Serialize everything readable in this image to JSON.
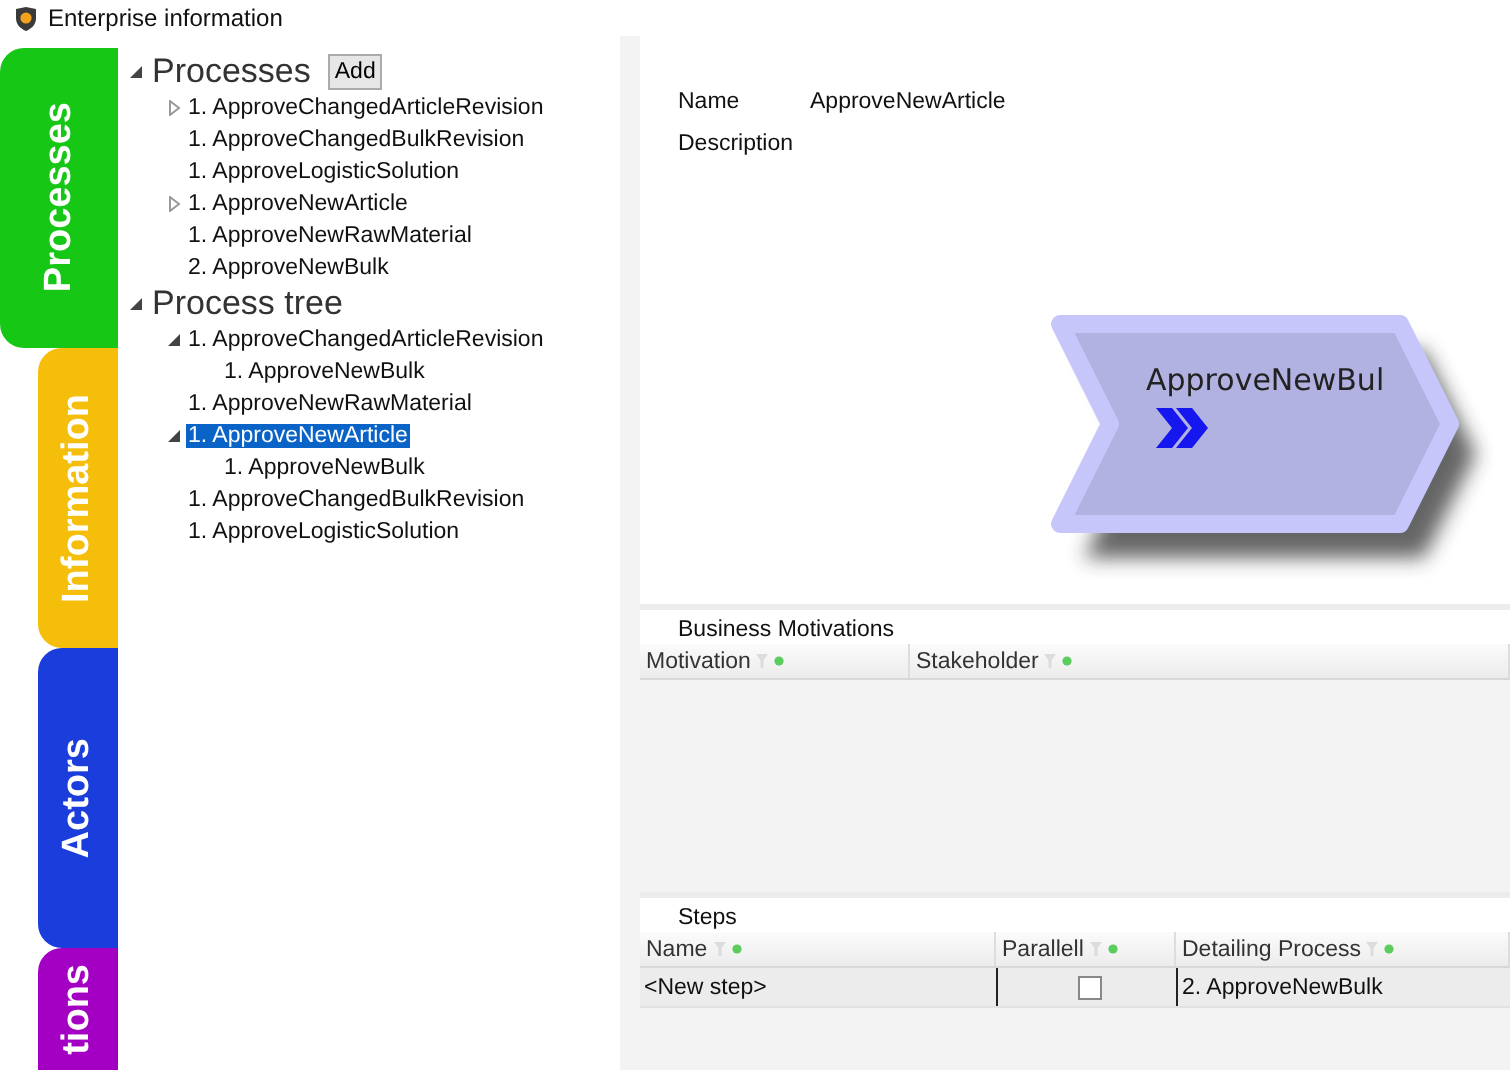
{
  "window": {
    "title": "Enterprise information"
  },
  "side_tabs": [
    {
      "label": "Processes",
      "color": "#16c716",
      "selected": true
    },
    {
      "label": "Information",
      "color": "#f5be0a",
      "selected": false
    },
    {
      "label": "Actors",
      "color": "#1a3ddc",
      "selected": false
    },
    {
      "label": "tions",
      "color": "#a400c4",
      "selected": false
    }
  ],
  "tree": [
    {
      "label": "Processes",
      "expanded": true,
      "button": "Add",
      "children": [
        {
          "label": "1. ApproveChangedArticleRevision",
          "expanded": false,
          "selected": false
        },
        {
          "label": "1. ApproveChangedBulkRevision",
          "selected": false
        },
        {
          "label": "1. ApproveLogisticSolution",
          "selected": false
        },
        {
          "label": "1. ApproveNewArticle",
          "expanded": false,
          "selected": false
        },
        {
          "label": "1. ApproveNewRawMaterial",
          "selected": false
        },
        {
          "label": "2. ApproveNewBulk",
          "selected": false
        }
      ]
    },
    {
      "label": "Process tree",
      "expanded": true,
      "children": [
        {
          "label": "1. ApproveChangedArticleRevision",
          "expanded": true,
          "selected": false,
          "children": [
            {
              "label": "1. ApproveNewBulk",
              "selected": false
            }
          ]
        },
        {
          "label": "1. ApproveNewRawMaterial",
          "selected": false
        },
        {
          "label": "1. ApproveNewArticle",
          "expanded": true,
          "selected": true,
          "children": [
            {
              "label": "1. ApproveNewBulk",
              "selected": false
            }
          ]
        },
        {
          "label": "1. ApproveChangedBulkRevision",
          "selected": false
        },
        {
          "label": "1. ApproveLogisticSolution",
          "selected": false
        }
      ]
    }
  ],
  "details": {
    "fields": [
      {
        "label": "Name",
        "value": "ApproveNewArticle"
      },
      {
        "label": "Description"
      }
    ]
  },
  "diagram": {
    "shape_label": "ApproveNewBul"
  },
  "business_motivations": {
    "title": "Business Motivations",
    "columns": [
      "Motivation",
      "Stakeholder"
    ]
  },
  "steps": {
    "title": "Steps",
    "columns": [
      "Name",
      "Parallell",
      "Detailing Process"
    ],
    "rows": [
      {
        "name": "<New step>",
        "parallel": false,
        "detailing_process": "2. ApproveNewBulk"
      }
    ]
  }
}
